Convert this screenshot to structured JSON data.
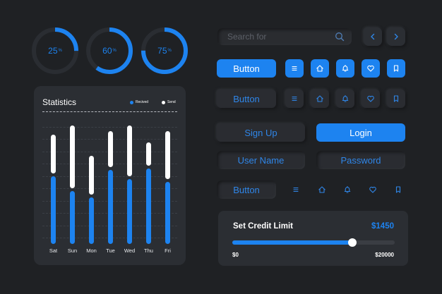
{
  "progress_rings": [
    {
      "value": 25,
      "label": "25",
      "suffix": "%"
    },
    {
      "value": 60,
      "label": "60",
      "suffix": "%"
    },
    {
      "value": 75,
      "label": "75",
      "suffix": "%"
    }
  ],
  "statistics": {
    "title": "Statistics",
    "legend": [
      {
        "label": "Recived",
        "color": "#1d83f0"
      },
      {
        "label": "Send",
        "color": "#ffffff"
      }
    ]
  },
  "chart_data": {
    "type": "bar",
    "title": "Statistics",
    "categories": [
      "Sat",
      "Sun",
      "Mon",
      "Tue",
      "Wed",
      "Thu",
      "Fri"
    ],
    "series": [
      {
        "name": "Recived",
        "values": [
          52,
          41,
          36,
          57,
          50,
          58,
          48
        ]
      },
      {
        "name": "Send",
        "values": [
          30,
          48,
          30,
          28,
          39,
          18,
          37
        ]
      }
    ],
    "ylim": [
      0,
      100
    ],
    "grid": true,
    "legend_position": "top-right"
  },
  "search": {
    "placeholder": "Search for",
    "icon": "search-icon"
  },
  "nav": {
    "prev_icon": "chevron-left-icon",
    "next_icon": "chevron-right-icon"
  },
  "buttons": {
    "button_primary": "Button",
    "button_secondary": "Button",
    "button_third": "Button",
    "sign_up": "Sign Up",
    "login": "Login"
  },
  "fields": {
    "username_placeholder": "User Name",
    "password_placeholder": "Password"
  },
  "icons": [
    "menu-icon",
    "home-icon",
    "bell-icon",
    "heart-icon",
    "bookmark-icon"
  ],
  "credit": {
    "title": "Set Credit Limit",
    "amount": "$1450",
    "min": "$0",
    "max": "$20000",
    "fraction": 0.74
  },
  "colors": {
    "background": "#1f2124",
    "accent": "#1d83f0",
    "card": "#2b2e33"
  }
}
